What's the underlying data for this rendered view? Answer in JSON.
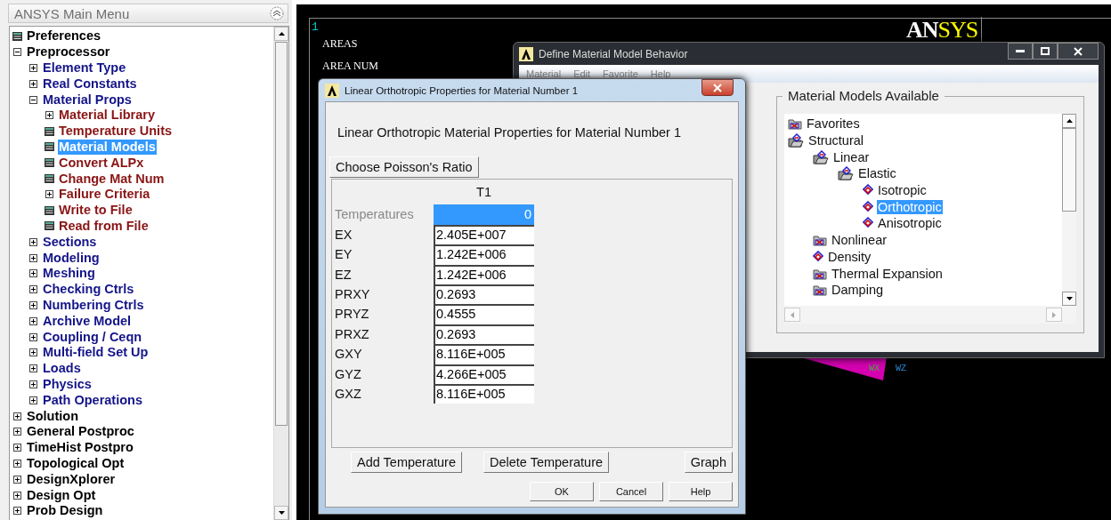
{
  "main_menu": {
    "title": "ANSYS Main Menu",
    "items": [
      {
        "label": "Preferences",
        "kind": "function",
        "selected": false
      },
      {
        "label": "Preprocessor",
        "kind": "folder",
        "expanded": true,
        "selected": false,
        "children": [
          {
            "label": "Element Type",
            "kind": "folder",
            "expanded": false,
            "selected": false
          },
          {
            "label": "Real Constants",
            "kind": "folder",
            "expanded": false,
            "selected": false
          },
          {
            "label": "Material Props",
            "kind": "folder",
            "expanded": true,
            "selected": false,
            "children": [
              {
                "label": "Material Library",
                "kind": "folder",
                "expanded": false,
                "selected": false
              },
              {
                "label": "Temperature Units",
                "kind": "function",
                "selected": false
              },
              {
                "label": "Material Models",
                "kind": "function",
                "selected": true
              },
              {
                "label": "Convert ALPx",
                "kind": "function",
                "selected": false
              },
              {
                "label": "Change Mat Num",
                "kind": "function",
                "selected": false
              },
              {
                "label": "Failure Criteria",
                "kind": "folder",
                "expanded": false,
                "selected": false
              },
              {
                "label": "Write to File",
                "kind": "function",
                "selected": false
              },
              {
                "label": "Read from File",
                "kind": "function",
                "selected": false
              }
            ]
          },
          {
            "label": "Sections",
            "kind": "folder",
            "expanded": false,
            "selected": false
          },
          {
            "label": "Modeling",
            "kind": "folder",
            "expanded": false,
            "selected": false
          },
          {
            "label": "Meshing",
            "kind": "folder",
            "expanded": false,
            "selected": false
          },
          {
            "label": "Checking Ctrls",
            "kind": "folder",
            "expanded": false,
            "selected": false
          },
          {
            "label": "Numbering Ctrls",
            "kind": "folder",
            "expanded": false,
            "selected": false
          },
          {
            "label": "Archive Model",
            "kind": "folder",
            "expanded": false,
            "selected": false
          },
          {
            "label": "Coupling / Ceqn",
            "kind": "folder",
            "expanded": false,
            "selected": false
          },
          {
            "label": "Multi-field Set Up",
            "kind": "folder",
            "expanded": false,
            "selected": false
          },
          {
            "label": "Loads",
            "kind": "folder",
            "expanded": false,
            "selected": false
          },
          {
            "label": "Physics",
            "kind": "folder",
            "expanded": false,
            "selected": false
          },
          {
            "label": "Path Operations",
            "kind": "folder",
            "expanded": false,
            "selected": false
          }
        ]
      },
      {
        "label": "Solution",
        "kind": "folder",
        "expanded": false,
        "selected": false
      },
      {
        "label": "General Postproc",
        "kind": "folder",
        "expanded": false,
        "selected": false
      },
      {
        "label": "TimeHist Postpro",
        "kind": "folder",
        "expanded": false,
        "selected": false
      },
      {
        "label": "Topological Opt",
        "kind": "folder",
        "expanded": false,
        "selected": false
      },
      {
        "label": "DesignXplorer",
        "kind": "folder",
        "expanded": false,
        "selected": false
      },
      {
        "label": "Design Opt",
        "kind": "folder",
        "expanded": false,
        "selected": false
      },
      {
        "label": "Prob Design",
        "kind": "folder",
        "expanded": false,
        "selected": false
      }
    ]
  },
  "graphics": {
    "window_number": "1",
    "lines": [
      "AREAS",
      "AREA NUM"
    ],
    "logo_left": "AN",
    "logo_right": "SYS",
    "axis_labels": [
      "WX",
      "WZ"
    ]
  },
  "material_window": {
    "title": "Define Material Model Behavior",
    "menu": [
      "Material",
      "Edit",
      "Favorite",
      "Help"
    ],
    "available_title": "Material Models Available",
    "tree": [
      {
        "label": "Favorites",
        "kind": "folder",
        "selected": false
      },
      {
        "label": "Structural",
        "kind": "open-folder",
        "selected": false,
        "children": [
          {
            "label": "Linear",
            "kind": "open-folder",
            "selected": false,
            "children": [
              {
                "label": "Elastic",
                "kind": "open-folder",
                "selected": false,
                "children": [
                  {
                    "label": "Isotropic",
                    "kind": "model",
                    "selected": false
                  },
                  {
                    "label": "Orthotropic",
                    "kind": "model",
                    "selected": true
                  },
                  {
                    "label": "Anisotropic",
                    "kind": "model",
                    "selected": false
                  }
                ]
              }
            ]
          },
          {
            "label": "Nonlinear",
            "kind": "folder",
            "selected": false
          },
          {
            "label": "Density",
            "kind": "model",
            "selected": false
          },
          {
            "label": "Thermal Expansion",
            "kind": "folder",
            "selected": false
          },
          {
            "label": "Damping",
            "kind": "folder",
            "selected": false
          }
        ]
      }
    ]
  },
  "ortho_dialog": {
    "title": "Linear Orthotropic Properties for Material Number 1",
    "heading": "Linear Orthotropic Material Properties for Material Number 1",
    "poisson_button": "Choose Poisson's Ratio",
    "column": "T1",
    "temperatures": {
      "label": "Temperatures",
      "value": "0",
      "selected": true
    },
    "properties": [
      {
        "label": "EX",
        "value": "2.405E+007"
      },
      {
        "label": "EY",
        "value": "1.242E+006"
      },
      {
        "label": "EZ",
        "value": "1.242E+006"
      },
      {
        "label": "PRXY",
        "value": "0.2693"
      },
      {
        "label": "PRYZ",
        "value": "0.4555"
      },
      {
        "label": "PRXZ",
        "value": "0.2693"
      },
      {
        "label": "GXY",
        "value": "8.116E+005"
      },
      {
        "label": "GYZ",
        "value": "4.266E+005"
      },
      {
        "label": "GXZ",
        "value": "8.116E+005"
      }
    ],
    "table_buttons": [
      "Add Temperature",
      "Delete Temperature",
      "Graph"
    ],
    "buttons": [
      "OK",
      "Cancel",
      "Help"
    ]
  }
}
